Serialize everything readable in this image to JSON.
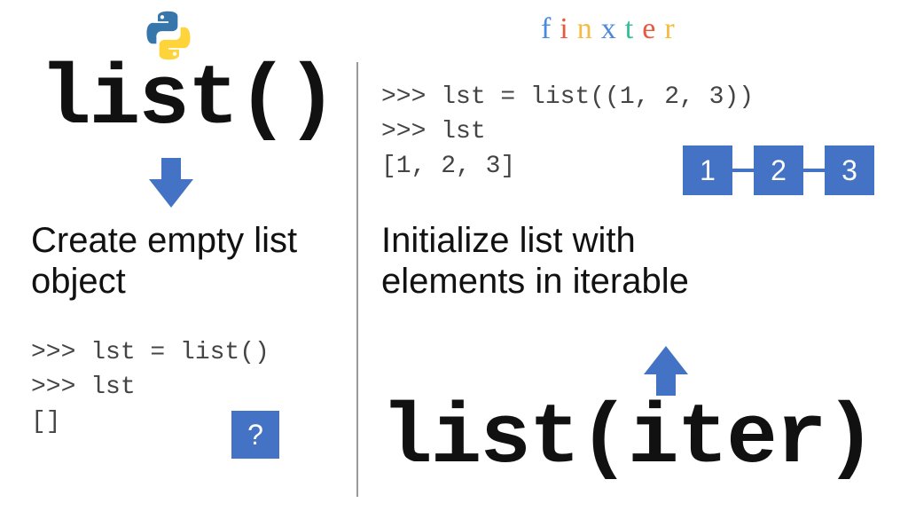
{
  "logo": {
    "finxter": [
      "f",
      "i",
      "n",
      "x",
      "t",
      "e",
      "r"
    ]
  },
  "left": {
    "title": "list()",
    "description": "Create empty list\nobject",
    "code": ">>> lst = list()\n>>> lst\n[]",
    "question": "?"
  },
  "right": {
    "title": "list(iter)",
    "description": "Initialize list with\nelements in iterable",
    "code": ">>> lst = list((1, 2, 3))\n>>> lst\n[1, 2, 3]",
    "nodes": [
      "1",
      "2",
      "3"
    ]
  },
  "colors": {
    "accent": "#4472c4"
  }
}
